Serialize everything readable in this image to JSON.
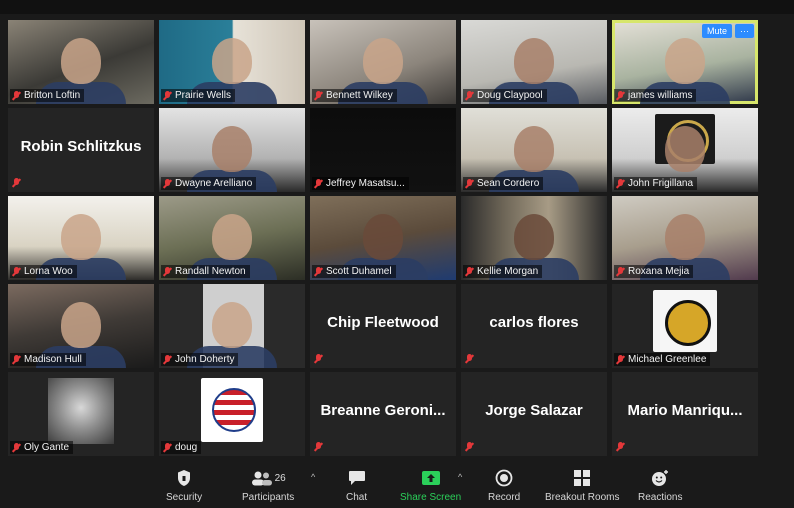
{
  "meeting": {
    "tiles": [
      {
        "name": "Britton Loftin",
        "kind": "video",
        "bg": "vid-a",
        "skin": "light"
      },
      {
        "name": "Prairie Wells",
        "kind": "video",
        "bg": "vid-b",
        "skin": "light"
      },
      {
        "name": "Bennett Wilkey",
        "kind": "video",
        "bg": "vid-c",
        "skin": "light"
      },
      {
        "name": "Doug Claypool",
        "kind": "video",
        "bg": "vid-d",
        "skin": "mid"
      },
      {
        "name": "james williams",
        "kind": "video",
        "bg": "vid-e",
        "skin": "light",
        "active": true
      },
      {
        "name": "Robin Schlitzkus",
        "kind": "name"
      },
      {
        "name": "Dwayne Arelliano",
        "kind": "video",
        "bg": "vid-f",
        "skin": "mid"
      },
      {
        "name": "Jeffrey Masatsu...",
        "kind": "video",
        "bg": "vid-g",
        "skin": "none"
      },
      {
        "name": "Sean Cordero",
        "kind": "video",
        "bg": "vid-h",
        "skin": "mid"
      },
      {
        "name": "John Frigillana",
        "kind": "badge"
      },
      {
        "name": "Lorna Woo",
        "kind": "video",
        "bg": "vid-i",
        "skin": "light"
      },
      {
        "name": "Randall Newton",
        "kind": "video",
        "bg": "vid-k",
        "skin": "light"
      },
      {
        "name": "Scott Duhamel",
        "kind": "video",
        "bg": "vid-l",
        "skin": "dark"
      },
      {
        "name": "Kellie Morgan",
        "kind": "video",
        "bg": "vid-m",
        "skin": "dark"
      },
      {
        "name": "Roxana Mejia",
        "kind": "video",
        "bg": "vid-n",
        "skin": "mid"
      },
      {
        "name": "Madison Hull",
        "kind": "video",
        "bg": "vid-o",
        "skin": "light"
      },
      {
        "name": "John Doherty",
        "kind": "video",
        "bg": "vid-p",
        "skin": "light"
      },
      {
        "name": "Chip Fleetwood",
        "kind": "name"
      },
      {
        "name": "carlos flores",
        "kind": "name"
      },
      {
        "name": "Michael Greenlee",
        "kind": "logo"
      },
      {
        "name": "Oly Gante",
        "kind": "cloud"
      },
      {
        "name": "doug",
        "kind": "flag"
      },
      {
        "name": "Breanne  Geroni...",
        "kind": "name"
      },
      {
        "name": "Jorge Salazar",
        "kind": "name"
      },
      {
        "name": "Mario  Manriqu...",
        "kind": "name"
      }
    ],
    "active_tile_buttons": {
      "mute": "Mute",
      "more": "···"
    }
  },
  "toolbar": {
    "security": "Security",
    "participants": "Participants",
    "participants_count": "26",
    "chat": "Chat",
    "share_screen": "Share Screen",
    "record": "Record",
    "breakout_rooms": "Breakout Rooms",
    "reactions": "Reactions"
  },
  "colors": {
    "active_speaker": "#d7e66b",
    "share_green": "#2bd05a",
    "muted_red": "#e3383a",
    "button_blue": "#2d8cff"
  }
}
